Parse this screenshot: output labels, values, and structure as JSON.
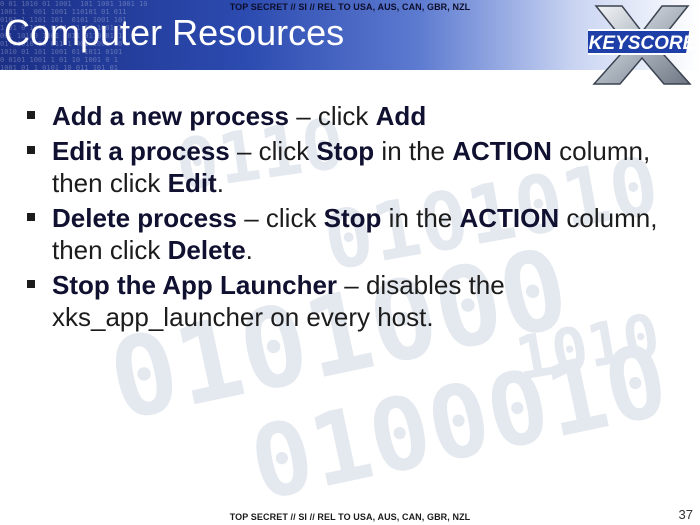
{
  "classification": {
    "top": "TOP SECRET // SI // REL TO USA, AUS, CAN, GBR, NZL",
    "bottom": "TOP SECRET // SI // REL TO USA, AUS, CAN, GBR, NZL"
  },
  "title": "Computer Resources",
  "logo": {
    "text": "KEYSCORE",
    "letter": "X"
  },
  "bullets": [
    {
      "segments": [
        {
          "text": "Add a new process",
          "bold": true
        },
        {
          "text": " – click ",
          "bold": false
        },
        {
          "text": "Add",
          "bold": true
        }
      ]
    },
    {
      "segments": [
        {
          "text": "Edit a process",
          "bold": true
        },
        {
          "text": " – click ",
          "bold": false
        },
        {
          "text": "Stop",
          "bold": true
        },
        {
          "text": " in the ",
          "bold": false
        },
        {
          "text": "ACTION",
          "bold": true
        },
        {
          "text": " column, then click ",
          "bold": false
        },
        {
          "text": "Edit",
          "bold": true
        },
        {
          "text": ".",
          "bold": false
        }
      ]
    },
    {
      "segments": [
        {
          "text": "Delete process",
          "bold": true
        },
        {
          "text": " – click ",
          "bold": false
        },
        {
          "text": "Stop",
          "bold": true
        },
        {
          "text": " in the ",
          "bold": false
        },
        {
          "text": "ACTION",
          "bold": true
        },
        {
          "text": " column, then click ",
          "bold": false
        },
        {
          "text": "Delete",
          "bold": true
        },
        {
          "text": ".",
          "bold": false
        }
      ]
    },
    {
      "segments": [
        {
          "text": "Stop the App Launcher",
          "bold": true
        },
        {
          "text": " – disables the xks_app_launcher on every host.",
          "bold": false
        }
      ]
    }
  ],
  "page_number": "37",
  "colors": {
    "header_dark": "#1b2f86",
    "header_mid": "#2c4bb0",
    "text": "#1c1c1c",
    "logo_blue": "#1f3fa8"
  }
}
